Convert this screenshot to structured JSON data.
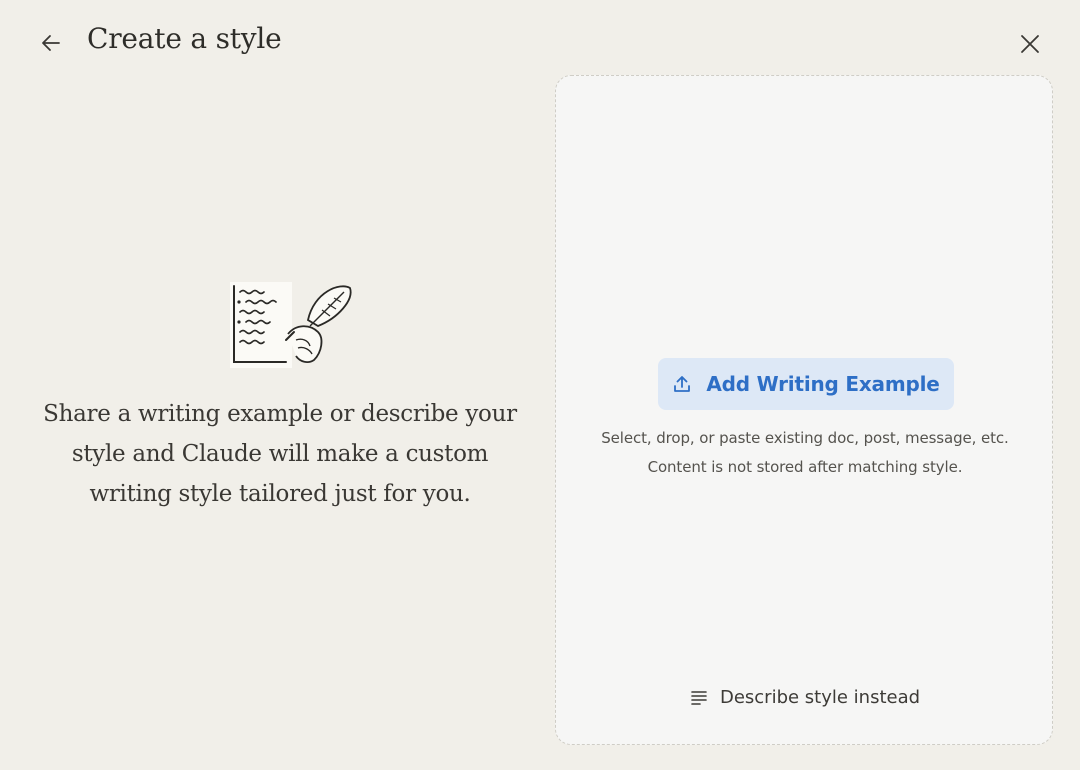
{
  "header": {
    "title": "Create a style",
    "back_icon": "arrow-left-icon",
    "close_icon": "close-icon"
  },
  "left": {
    "illustration": "quill-document-illustration",
    "description": "Share a writing example or describe your style and Claude will make a custom writing style tailored just for you."
  },
  "upload": {
    "add_button_label": "Add Writing Example",
    "add_button_icon": "upload-icon",
    "hint_line1": "Select, drop, or paste existing doc, post, message, etc.",
    "hint_line2": "Content is not stored after matching style.",
    "describe_label": "Describe style instead",
    "describe_icon": "text-lines-icon"
  },
  "colors": {
    "background": "#f1efe9",
    "panel": "#f6f6f5",
    "accent": "#2e6fc6",
    "accent_bg": "#dde8f6"
  }
}
